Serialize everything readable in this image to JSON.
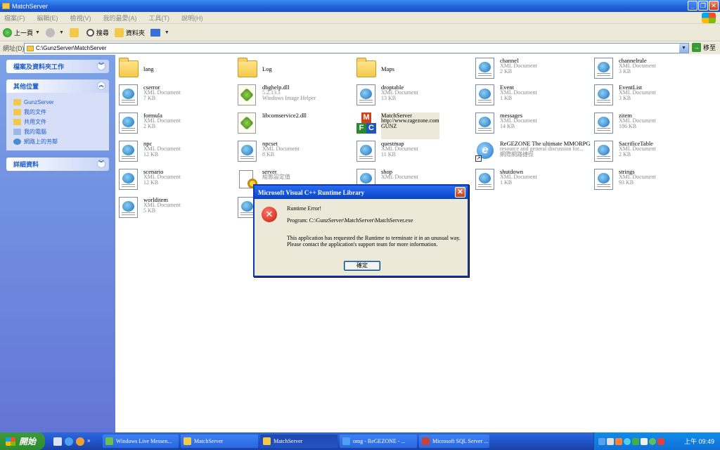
{
  "window": {
    "title": "MatchServer"
  },
  "menu": [
    "檔案(F)",
    "編輯(E)",
    "檢視(V)",
    "我的最愛(A)",
    "工具(T)",
    "說明(H)"
  ],
  "toolbar": {
    "back": "上一頁",
    "search": "搜尋",
    "folders": "資料夾"
  },
  "address": {
    "label": "網址(D)",
    "path": "C:\\GunzServer\\MatchServer",
    "go": "移至"
  },
  "sidebar": {
    "tasks_title": "檔案及資料夾工作",
    "places_title": "其他位置",
    "places": [
      "GunzServer",
      "我的文件",
      "共用文件",
      "我的電腦",
      "網路上的芳鄰"
    ],
    "details_title": "詳細資料"
  },
  "files": [
    {
      "name": "lang",
      "type": "",
      "size": "",
      "kind": "folder"
    },
    {
      "name": "Log",
      "type": "",
      "size": "",
      "kind": "folder"
    },
    {
      "name": "Maps",
      "type": "",
      "size": "",
      "kind": "folder"
    },
    {
      "name": "channel",
      "type": "XML Document",
      "size": "2 KB",
      "kind": "xml"
    },
    {
      "name": "channelrule",
      "type": "XML Document",
      "size": "3 KB",
      "kind": "xml"
    },
    {
      "name": "cserror",
      "type": "XML Document",
      "size": "7 KB",
      "kind": "xml"
    },
    {
      "name": "dbghelp.dll",
      "type": "5.2.13.1",
      "size": "Windows Image Helper",
      "kind": "dll"
    },
    {
      "name": "droptable",
      "type": "XML Document",
      "size": "13 KB",
      "kind": "xml"
    },
    {
      "name": "Event",
      "type": "XML Document",
      "size": "1 KB",
      "kind": "xml"
    },
    {
      "name": "EventList",
      "type": "XML Document",
      "size": "3 KB",
      "kind": "xml"
    },
    {
      "name": "formula",
      "type": "XML Document",
      "size": "2 KB",
      "kind": "xml"
    },
    {
      "name": "libcomservice2.dll",
      "type": "",
      "size": "",
      "kind": "dll"
    },
    {
      "name": "MatchServer",
      "type": "http://www.ragezone.com",
      "size": "GUNZ",
      "kind": "mfc"
    },
    {
      "name": "messages",
      "type": "XML Document",
      "size": "14 KB",
      "kind": "xml"
    },
    {
      "name": "zitem",
      "type": "XML Document",
      "size": "186 KB",
      "kind": "xml"
    },
    {
      "name": "npc",
      "type": "XML Document",
      "size": "12 KB",
      "kind": "xml"
    },
    {
      "name": "npcset",
      "type": "XML Document",
      "size": "8 KB",
      "kind": "xml"
    },
    {
      "name": "questmap",
      "type": "XML Document",
      "size": "11 KB",
      "kind": "xml"
    },
    {
      "name": "ReGEZONE The ultimate MMORPG",
      "type": "resource and general discussion for...",
      "size": "網際網路捷徑",
      "kind": "ie"
    },
    {
      "name": "SacrificeTable",
      "type": "XML Document",
      "size": "2 KB",
      "kind": "xml"
    },
    {
      "name": "scenario",
      "type": "XML Document",
      "size": "12 KB",
      "kind": "xml"
    },
    {
      "name": "server",
      "type": "組態設定值",
      "size": "",
      "kind": "cfg"
    },
    {
      "name": "shop",
      "type": "XML Document",
      "size": "",
      "kind": "xml"
    },
    {
      "name": "shutdown",
      "type": "XML Document",
      "size": "1 KB",
      "kind": "xml"
    },
    {
      "name": "strings",
      "type": "XML Document",
      "size": "93 KB",
      "kind": "xml"
    },
    {
      "name": "worlditem",
      "type": "XML Document",
      "size": "5 KB",
      "kind": "xml"
    },
    {
      "name": "",
      "type": "",
      "size": "",
      "kind": "xml"
    }
  ],
  "dialog": {
    "title": "Microsoft Visual C++ Runtime Library",
    "heading": "Runtime Error!",
    "program": "Program: C:\\GunzServer\\MatchServer\\MatchServer.exe",
    "message1": "This application has requested the Runtime to terminate it in an unusual way.",
    "message2": "Please contact the application's support team for more information.",
    "ok": "確定"
  },
  "taskbar": {
    "start": "開始",
    "tasks": [
      "Windows Live Messen...",
      "MatchServer",
      "MatchServer",
      "omg - ReGEZONE - ...",
      "Microsoft SQL Server ..."
    ],
    "clock": "上午 09:49"
  }
}
